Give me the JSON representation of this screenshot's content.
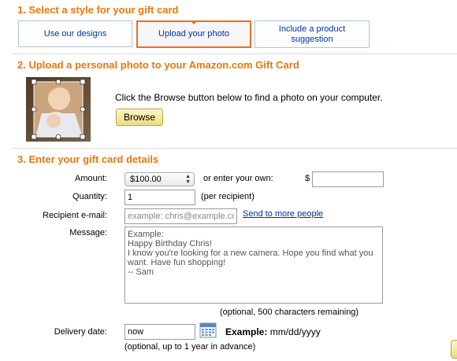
{
  "section1": {
    "title": "1. Select a style for your gift card",
    "options": [
      {
        "label": "Use our designs",
        "selected": false
      },
      {
        "label": "Upload your photo",
        "selected": true
      },
      {
        "label": "Include a product suggestion",
        "selected": false
      }
    ]
  },
  "section2": {
    "title": "2. Upload a personal photo to your Amazon.com Gift Card",
    "instruction": "Click the Browse button below to find a photo on your computer.",
    "browse_label": "Browse"
  },
  "section3": {
    "title": "3. Enter your gift card details",
    "amount_label": "Amount:",
    "amount_selected": "$100.00",
    "enter_own_label": "or enter your own:",
    "currency_symbol": "$",
    "custom_amount_value": "",
    "quantity_label": "Quantity:",
    "quantity_value": "1",
    "per_recipient": "(per recipient)",
    "recipient_label": "Recipient e-mail:",
    "recipient_placeholder": "example: chris@example.com",
    "send_more_link": "Send to more people",
    "message_label": "Message:",
    "message_text": "Example:\nHappy Birthday Chris!\nI know you're looking for a new camera. Hope you find what you want. Have fun shopping!\n-- Sam",
    "message_hint": "(optional, 500 characters remaining)",
    "delivery_label": "Delivery date:",
    "delivery_value": "now",
    "example_label": "Example:",
    "example_format": "mm/dd/yyyy",
    "delivery_hint": "(optional, up to 1 year in advance)"
  },
  "colors": {
    "section_title": "#e47911",
    "selected_border": "#e9711c",
    "link": "#003399"
  }
}
